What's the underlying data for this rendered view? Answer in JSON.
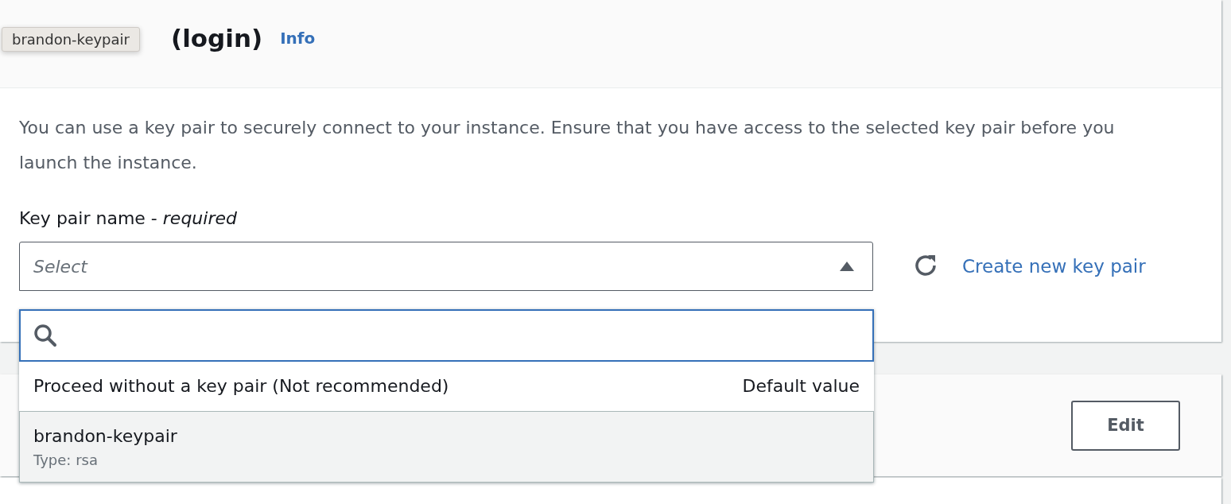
{
  "tooltip": {
    "text": "brandon-keypair"
  },
  "key_pair_section": {
    "title": "(login)",
    "info_link": "Info",
    "description": "You can use a key pair to securely connect to your instance. Ensure that you have access to the selected key pair before you launch the instance.",
    "field_label": "Key pair name - *required*",
    "select": {
      "placeholder": "Select",
      "expanded": true
    },
    "create_link": "Create new key pair"
  },
  "options": [
    {
      "label": "Proceed without a key pair (Not recommended)",
      "tag": "Default value",
      "highlighted": false
    },
    {
      "label": "brandon-keypair",
      "description": "Type: rsa",
      "highlighted": true
    }
  ],
  "next_section": {
    "edit_button": "Edit"
  }
}
